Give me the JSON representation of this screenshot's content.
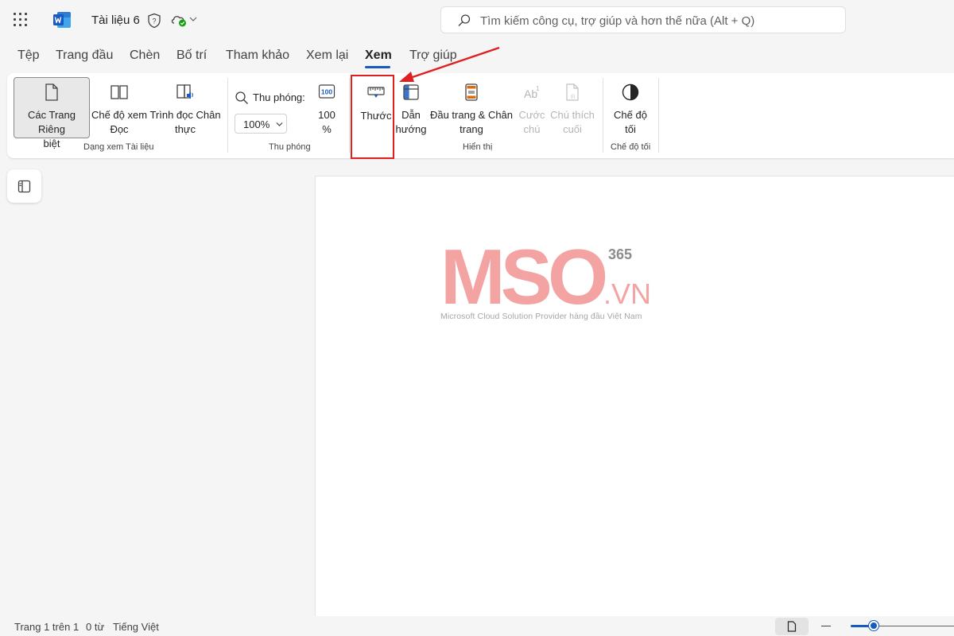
{
  "titlebar": {
    "doc_title": "Tài liệu 6",
    "search_placeholder": "Tìm kiếm công cụ, trợ giúp và hơn thế nữa (Alt + Q)"
  },
  "tabs": [
    {
      "label": "Tệp"
    },
    {
      "label": "Trang đầu"
    },
    {
      "label": "Chèn"
    },
    {
      "label": "Bố trí"
    },
    {
      "label": "Tham khảo"
    },
    {
      "label": "Xem lại"
    },
    {
      "label": "Xem",
      "active": true
    },
    {
      "label": "Trợ giúp"
    }
  ],
  "ribbon": {
    "doc_views": {
      "group_label": "Dạng xem Tài liệu",
      "separate_pages": [
        "Các Trang Riêng",
        "biệt"
      ],
      "reading_mode": [
        "Chế độ xem",
        "Đọc"
      ],
      "immersive_reader": [
        "Trình đọc Chân",
        "thực"
      ]
    },
    "zoom": {
      "group_label": "Thu phóng",
      "zoom_label": "Thu phóng:",
      "zoom_value": "100%",
      "hundred": [
        "100",
        "%"
      ]
    },
    "show": {
      "group_label": "Hiển thị",
      "ruler": "Thước",
      "navigation": [
        "Dẫn",
        "hướng"
      ],
      "header_footer": [
        "Đầu trang & Chân",
        "trang"
      ],
      "footnotes": [
        "Cước",
        "chú"
      ],
      "endnotes": [
        "Chú thích",
        "cuối"
      ]
    },
    "dark": {
      "group_label": "Chế độ tối",
      "dark_mode": [
        "Chế độ",
        "tối"
      ]
    }
  },
  "document": {
    "logo_text": "MSO",
    "logo_superscript": "365",
    "logo_suffix": ".VN",
    "logo_tagline": "Microsoft Cloud Solution Provider hàng đầu Việt Nam"
  },
  "statusbar": {
    "page_info": "Trang 1 trên 1",
    "word_count": "0 từ",
    "language": "Tiếng Việt",
    "zoom_level": 0.22
  },
  "colors": {
    "word_blue": "#185abd",
    "highlight_red": "#e02020",
    "logo_pink": "#f4a3a3",
    "logo_gray": "#8c8c8c"
  },
  "icons": {
    "app_launcher": "waffle-icon",
    "search": "search-icon",
    "ruler": "ruler-icon",
    "dark_mode": "contrast-icon"
  }
}
